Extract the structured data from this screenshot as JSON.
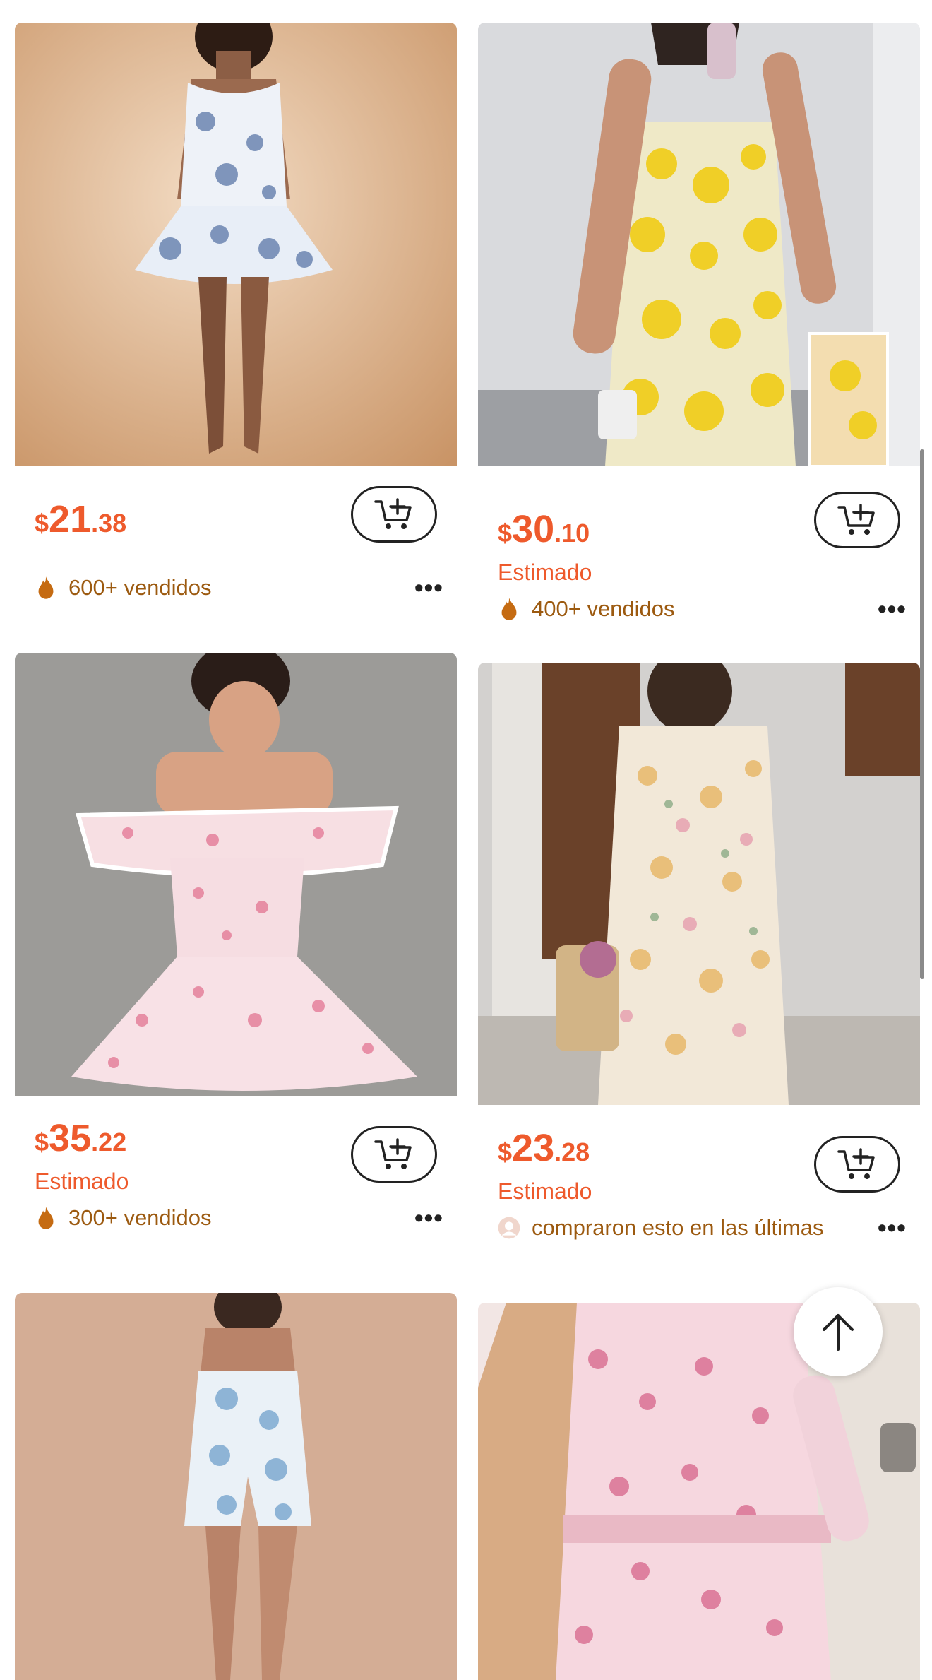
{
  "products": [
    {
      "price": {
        "currency": "$",
        "integer": "21",
        "decimal": ".38"
      },
      "estimate": "",
      "sold": "600+ vendidos",
      "meta_icon": "fire-icon",
      "image": "Blue floral toile corset mini dress"
    },
    {
      "price": {
        "currency": "$",
        "integer": "30",
        "decimal": ".10"
      },
      "estimate": "Estimado",
      "sold": "400+ vendidos",
      "meta_icon": "fire-icon",
      "image": "Yellow 3D floral sleeveless shift dress"
    },
    {
      "price": {
        "currency": "$",
        "integer": "35",
        "decimal": ".22"
      },
      "estimate": "Estimado",
      "sold": "300+ vendidos",
      "meta_icon": "fire-icon",
      "image": "Pink floral off-shoulder ruffle dress"
    },
    {
      "price": {
        "currency": "$",
        "integer": "23",
        "decimal": ".28"
      },
      "estimate": "Estimado",
      "sold": "compraron esto en las últimas",
      "meta_icon": "user-icon",
      "image": "Cream floral lace cap sleeve dress"
    },
    {
      "image": "Blue floral print slit mini dress"
    },
    {
      "image": "Pink floral print pleated blouse and skirt set"
    }
  ],
  "colors": {
    "price": "#ee5a2c",
    "sold_text": "#9c5a10",
    "fire_icon": "#c56b12"
  },
  "icons": {
    "cart": "add-to-cart-icon",
    "more": "more-dots-icon",
    "scroll_top": "arrow-up-icon"
  }
}
